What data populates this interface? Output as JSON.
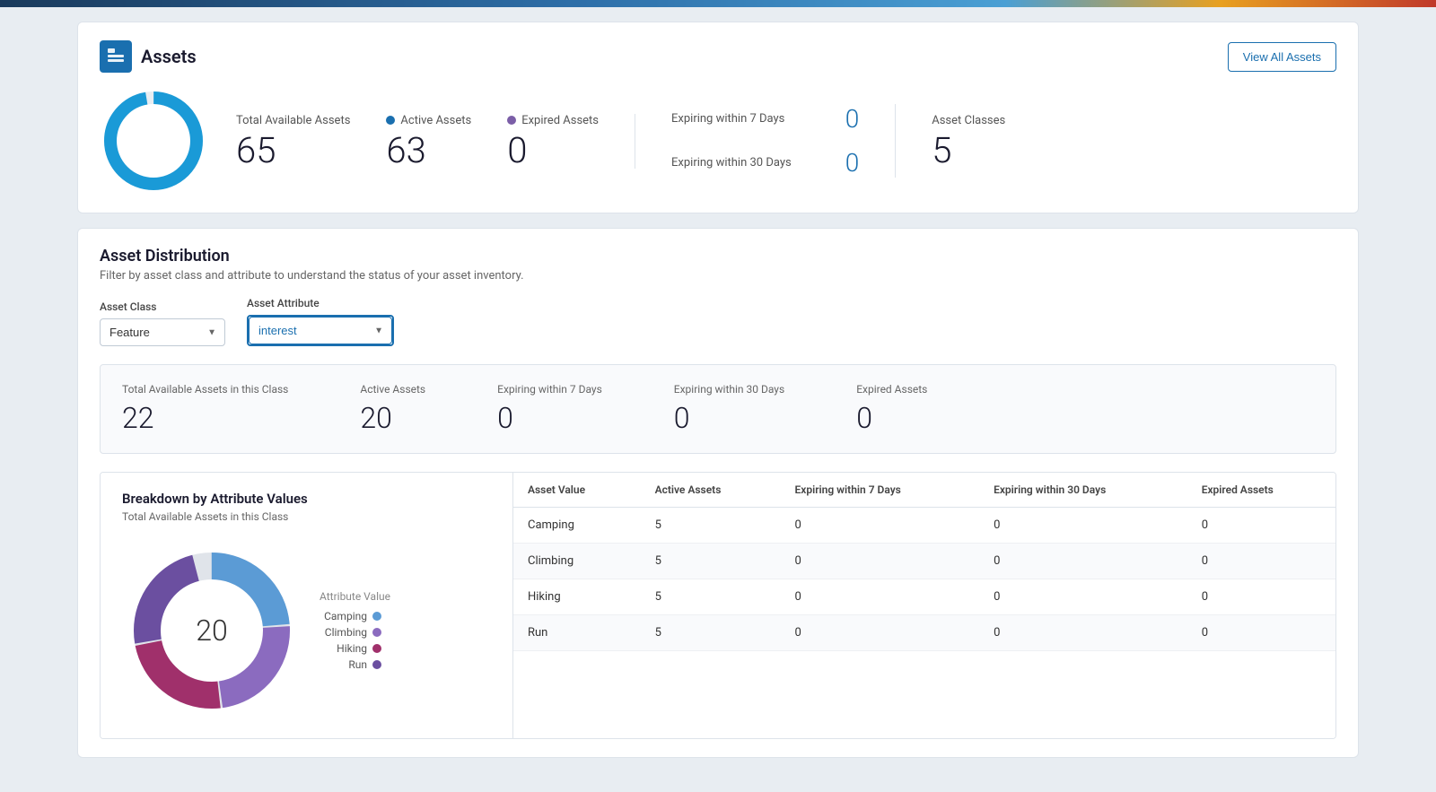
{
  "topBar": {},
  "assetsCard": {
    "icon": "≡",
    "title": "Assets",
    "viewAllBtn": "View All Assets",
    "totalAvailableLabel": "Total Available Assets",
    "totalAvailableValue": "65",
    "activeAssetsLabel": "Active Assets",
    "activeAssetsValue": "63",
    "expiredAssetsLabel": "Expired Assets",
    "expiredAssetsValue": "0",
    "expiringIn7Label": "Expiring within 7 Days",
    "expiringIn7Value": "0",
    "expiringIn30Label": "Expiring within 30 Days",
    "expiringIn30Value": "0",
    "assetClassesLabel": "Asset Classes",
    "assetClassesValue": "5"
  },
  "distributionSection": {
    "title": "Asset Distribution",
    "subtitle": "Filter by asset class and attribute to understand the status of your asset inventory.",
    "assetClassLabel": "Asset Class",
    "assetClassValue": "Feature",
    "assetAttributeLabel": "Asset Attribute",
    "assetAttributeValue": "interest",
    "statsRow": {
      "totalLabel": "Total Available Assets in this Class",
      "totalValue": "22",
      "activeLabel": "Active Assets",
      "activeValue": "20",
      "expiring7Label": "Expiring within 7 Days",
      "expiring7Value": "0",
      "expiring30Label": "Expiring within 30 Days",
      "expiring30Value": "0",
      "expiredLabel": "Expired Assets",
      "expiredValue": "0"
    },
    "breakdownTitle": "Breakdown by Attribute Values",
    "breakdownSubtitle": "Total Available Assets in this Class",
    "donutCenter": "20",
    "legend": [
      {
        "label": "Camping",
        "color": "#5b9bd5"
      },
      {
        "label": "Climbing",
        "color": "#7b5ea7"
      },
      {
        "label": "Hiking",
        "color": "#c0392b"
      },
      {
        "label": "Run",
        "color": "#6b4fa0"
      }
    ],
    "tableHeaders": [
      "Asset Value",
      "Active Assets",
      "Expiring within 7 Days",
      "Expiring within 30 Days",
      "Expired Assets"
    ],
    "tableRows": [
      {
        "assetValue": "Camping",
        "active": "5",
        "exp7": "0",
        "exp30": "0",
        "expired": "0"
      },
      {
        "assetValue": "Climbing",
        "active": "5",
        "exp7": "0",
        "exp30": "0",
        "expired": "0"
      },
      {
        "assetValue": "Hiking",
        "active": "5",
        "exp7": "0",
        "exp30": "0",
        "expired": "0"
      },
      {
        "assetValue": "Run",
        "active": "5",
        "exp7": "0",
        "exp30": "0",
        "expired": "0"
      }
    ]
  }
}
